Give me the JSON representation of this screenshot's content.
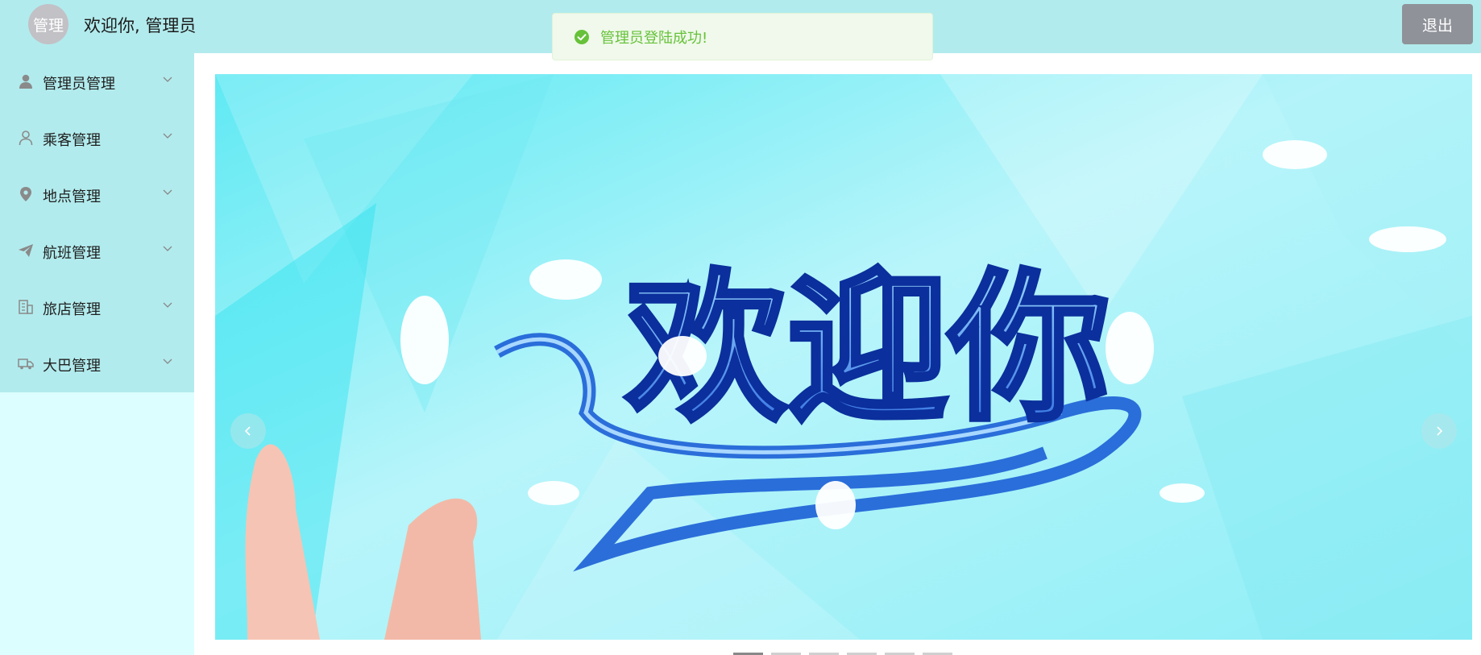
{
  "header": {
    "avatar_text": "管理",
    "welcome_text": "欢迎你, 管理员",
    "logout_label": "退出"
  },
  "toast": {
    "message": "管理员登陆成功!",
    "type": "success",
    "color": "#67c23a"
  },
  "sidebar": {
    "items": [
      {
        "label": "管理员管理",
        "icon": "user-filled-icon"
      },
      {
        "label": "乘客管理",
        "icon": "user-outline-icon"
      },
      {
        "label": "地点管理",
        "icon": "location-pin-icon"
      },
      {
        "label": "航班管理",
        "icon": "paper-plane-icon"
      },
      {
        "label": "旅店管理",
        "icon": "office-building-icon"
      },
      {
        "label": "大巴管理",
        "icon": "truck-icon"
      }
    ]
  },
  "carousel": {
    "banner_text": "欢迎你",
    "slides_count": 6,
    "active_index": 0
  },
  "colors": {
    "header_bg": "#b2ebed",
    "sidebar_bg": "#dcfefe",
    "logout_bg": "#8f9298"
  }
}
